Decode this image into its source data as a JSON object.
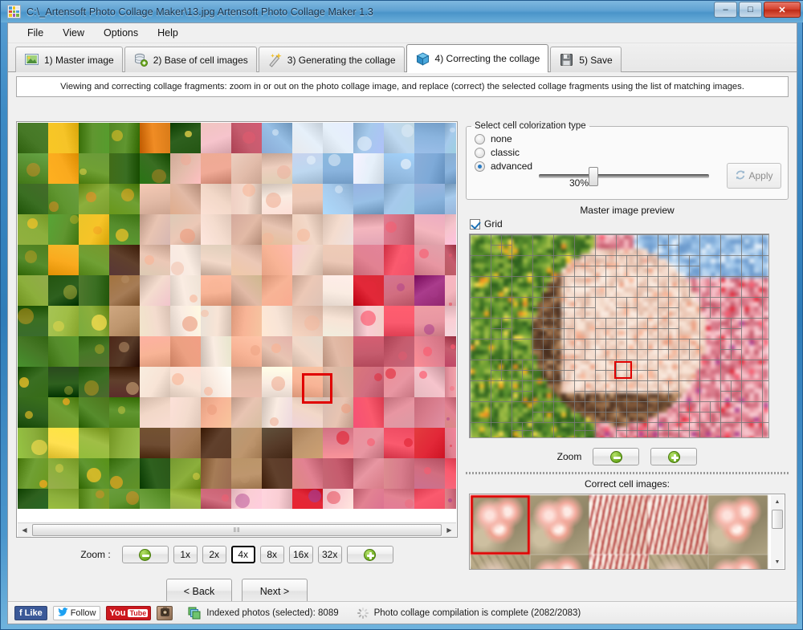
{
  "window": {
    "title": "C:\\_Artensoft Photo Collage Maker\\13.jpg Artensoft Photo Collage Maker 1.3",
    "app_icon": "collage-app-icon",
    "buttons": {
      "minimize": "–",
      "maximize": "□",
      "close": "✕"
    }
  },
  "menu": {
    "items": [
      {
        "label": "File"
      },
      {
        "label": "View"
      },
      {
        "label": "Options"
      },
      {
        "label": "Help"
      }
    ]
  },
  "tabs": [
    {
      "label": "1) Master image",
      "icon": "picture-icon",
      "active": false
    },
    {
      "label": "2) Base of cell images",
      "icon": "database-add-icon",
      "active": false
    },
    {
      "label": "3) Generating the collage",
      "icon": "magic-wand-icon",
      "active": false
    },
    {
      "label": "4) Correcting the collage",
      "icon": "blue-box-icon",
      "active": true
    },
    {
      "label": "5) Save",
      "icon": "floppy-disk-icon",
      "active": false
    }
  ],
  "banner": {
    "text": "Viewing and correcting collage fragments: zoom in or out on the photo collage image, and replace (correct) the selected collage fragments using the list of matching images."
  },
  "colorization": {
    "legend": "Select cell colorization type",
    "options": [
      {
        "label": "none",
        "selected": false
      },
      {
        "label": "classic",
        "selected": false
      },
      {
        "label": "advanced",
        "selected": true
      }
    ],
    "slider_value": "30%",
    "slider_percent": 30,
    "apply_label": "Apply",
    "apply_icon": "refresh-icon",
    "apply_enabled": false
  },
  "preview": {
    "title": "Master image preview",
    "grid_label": "Grid",
    "grid_checked": true,
    "zoom_label": "Zoom",
    "zoom_out_icon": "zoom-out-icon",
    "zoom_in_icon": "zoom-in-icon"
  },
  "cells": {
    "title": "Correct cell images:",
    "selected_index": 0,
    "scroll_up_icon": "scroll-up-icon",
    "scroll_down_icon": "scroll-down-icon"
  },
  "viewer": {
    "zoom_label": "Zoom  :",
    "zoom_out_icon": "zoom-out-icon",
    "zoom_in_icon": "zoom-in-icon",
    "zoom_levels": [
      {
        "label": "1x",
        "selected": false
      },
      {
        "label": "2x",
        "selected": false
      },
      {
        "label": "4x",
        "selected": true
      },
      {
        "label": "8x",
        "selected": false
      },
      {
        "label": "16x",
        "selected": false
      },
      {
        "label": "32x",
        "selected": false
      }
    ],
    "scroll_left_icon": "scroll-left-icon",
    "scroll_right_icon": "scroll-right-icon",
    "scroll_thumb_grip": "‖‖"
  },
  "navigation": {
    "back_label": "< Back",
    "next_label": "Next >"
  },
  "status": {
    "social": [
      {
        "name": "facebook-like",
        "label": "Like",
        "glyph": "f"
      },
      {
        "name": "twitter-follow",
        "label": "Follow",
        "glyph": "🐦"
      },
      {
        "name": "youtube",
        "label": "Tube",
        "prefix": "You"
      },
      {
        "name": "instagram",
        "label": ""
      }
    ],
    "indexed_icon": "photos-stack-icon",
    "indexed_text": "Indexed photos (selected): 8089",
    "progress_icon": "progress-spinner-icon",
    "progress_text": "Photo collage compilation is complete (2082/2083)"
  },
  "colors": {
    "accent": "#2a7ac2",
    "selection_red": "#e00000",
    "title_blue": "#5fa2d2",
    "green_button": "#6aa81d"
  }
}
